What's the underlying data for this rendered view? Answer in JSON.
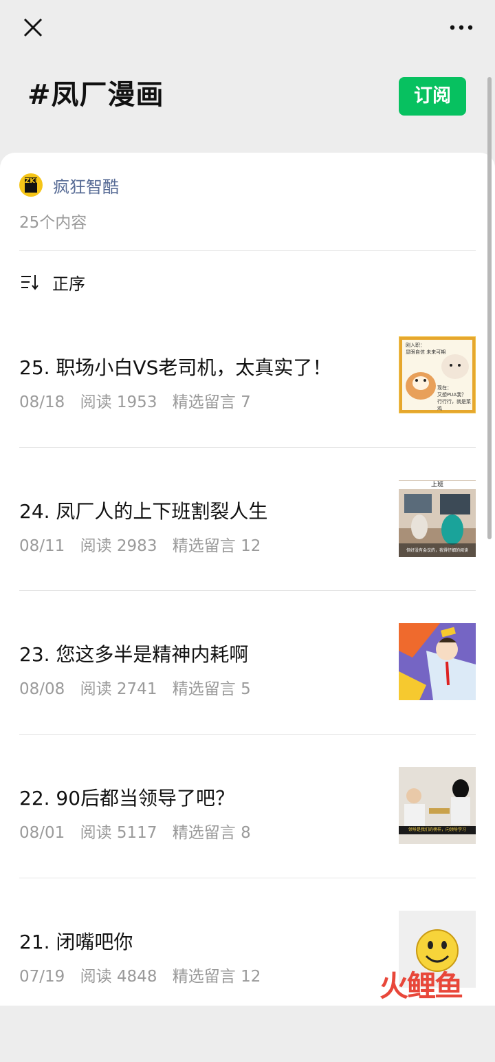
{
  "header": {
    "title": "#凤厂漫画",
    "subscribe_label": "订阅"
  },
  "account": {
    "name": "疯狂智酷",
    "avatar_text": "ZKU",
    "content_count": "25个内容"
  },
  "sort": {
    "label": "正序"
  },
  "articles": [
    {
      "title": "25. 职场小白VS老司机，太真实了！",
      "date": "08/18",
      "reads": "阅读 1953",
      "comments": "精选留言 7",
      "thumb": {
        "top_text": "刚入职：\n显眼自信  未来可期",
        "bottom_text": "现在：\n又想PUA我？\n行行行，就是菜鸡"
      }
    },
    {
      "title": "24. 凤厂人的上下班割裂人生",
      "date": "08/11",
      "reads": "阅读 2983",
      "comments": "精选留言 12",
      "thumb": {
        "top_text": "上班",
        "bottom_text": "但好没有会议的，我得仔细的阅读"
      }
    },
    {
      "title": "23. 您这多半是精神内耗啊",
      "date": "08/08",
      "reads": "阅读 2741",
      "comments": "精选留言 5"
    },
    {
      "title": "22. 90后都当领导了吧？",
      "date": "08/01",
      "reads": "阅读 5117",
      "comments": "精选留言 8",
      "thumb": {
        "bottom_text": "领导是我们的榜样，向领导学习"
      }
    },
    {
      "title": "21. 闭嘴吧你",
      "date": "07/19",
      "reads": "阅读 4848",
      "comments": "精选留言 12"
    }
  ],
  "watermark": "火鲤鱼",
  "colors": {
    "accent": "#07c160",
    "link": "#576b95",
    "meta": "#9a9a9a",
    "background": "#ededed"
  }
}
